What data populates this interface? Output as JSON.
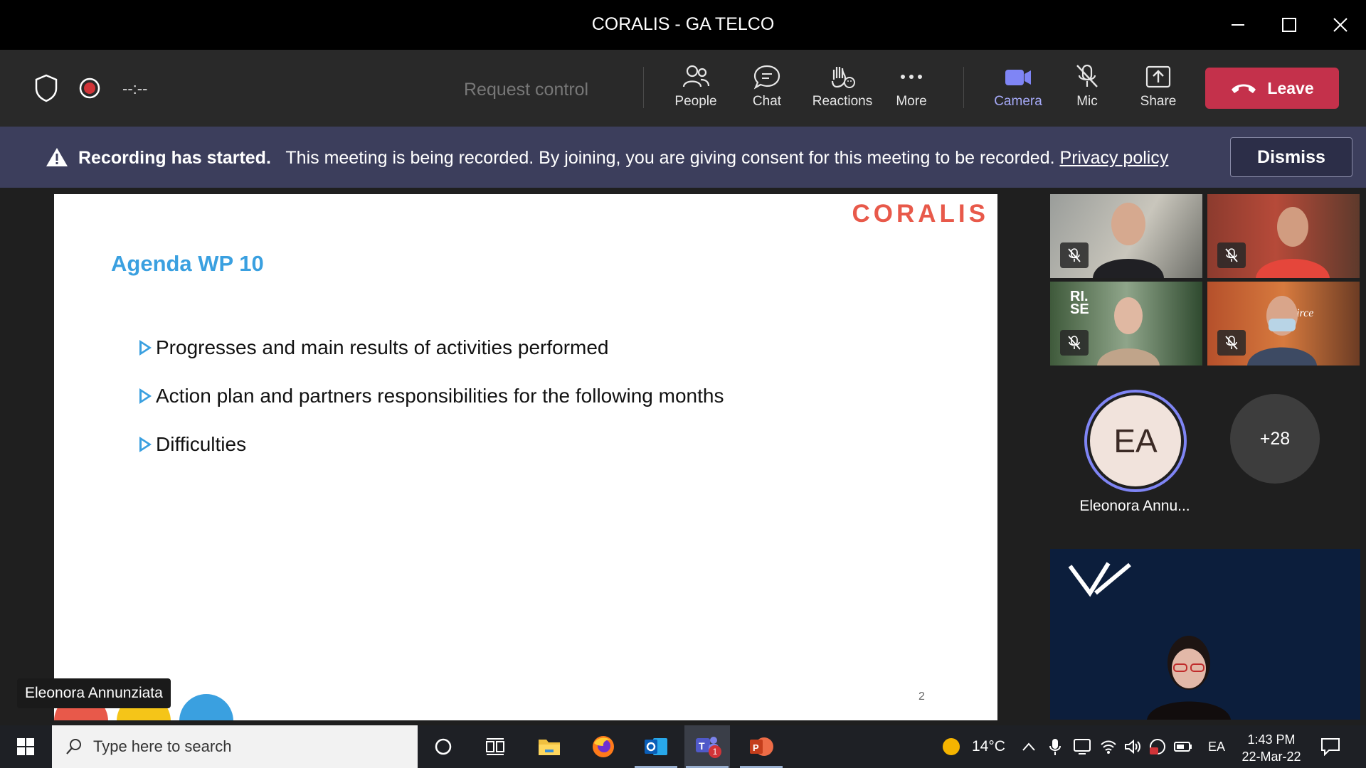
{
  "window": {
    "title": "CORALIS - GA TELCO"
  },
  "toolbar": {
    "timer": "--:--",
    "request_control": "Request control",
    "people": "People",
    "chat": "Chat",
    "reactions": "Reactions",
    "more": "More",
    "camera": "Camera",
    "mic": "Mic",
    "share": "Share",
    "leave": "Leave",
    "camera_color": "#7f85f5",
    "leave_color": "#c4314b"
  },
  "banner": {
    "title": "Recording has started.",
    "message": "This meeting is being recorded. By joining, you are giving consent for this meeting to be recorded.",
    "link": "Privacy policy",
    "dismiss": "Dismiss"
  },
  "slide": {
    "logo": "CORALIS",
    "title": "Agenda WP 10",
    "bullets": [
      "Progresses and main results of activities performed",
      "Action plan and partners responsibilities for the following months",
      "Difficulties"
    ],
    "page_number": "2",
    "presenter": "Eleonora Annunziata"
  },
  "participants": {
    "avatar_initials": "EA",
    "avatar_name": "Eleonora Annu...",
    "more_count": "+28",
    "tile_labels": [
      "RI.\nSE",
      "circe"
    ]
  },
  "taskbar": {
    "search_placeholder": "Type here to search",
    "weather": "14°C",
    "language": "EA",
    "time": "1:43 PM",
    "date": "22-Mar-22",
    "teams_badge": "1"
  }
}
